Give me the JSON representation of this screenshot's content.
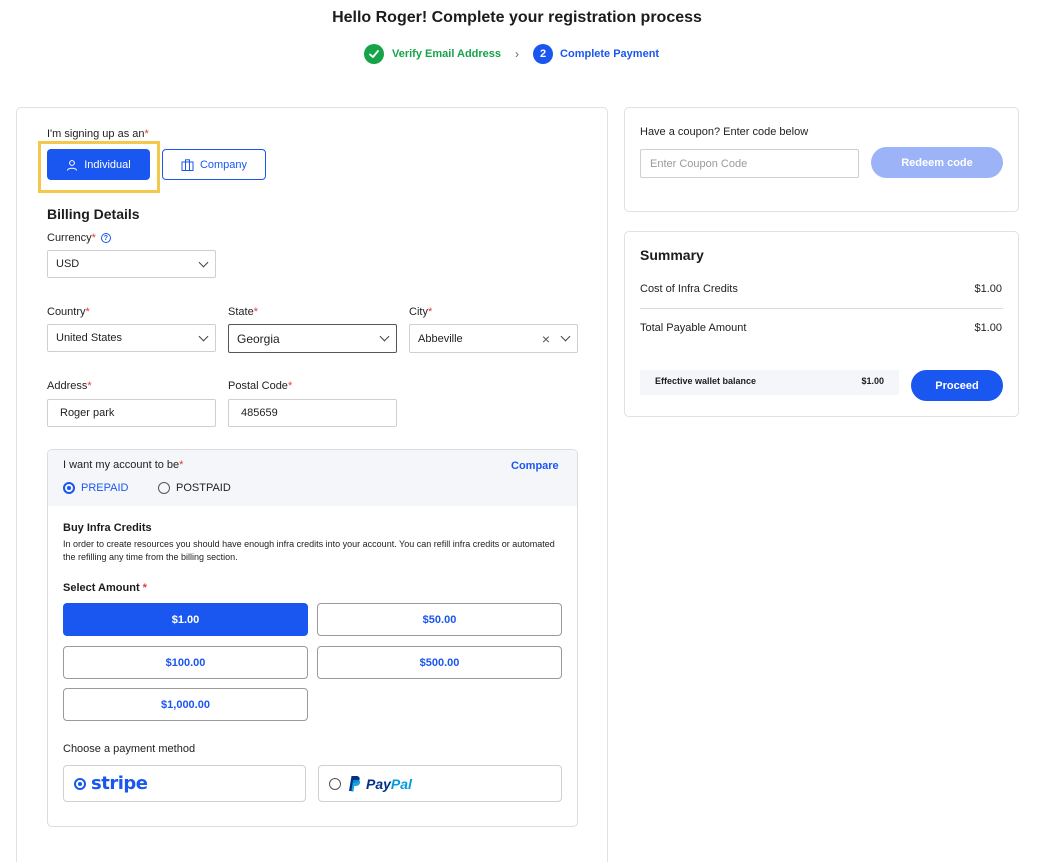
{
  "header": {
    "title": "Hello Roger! Complete your registration process",
    "step1_label": "Verify Email Address",
    "step2_number": "2",
    "step2_label": "Complete Payment"
  },
  "account_type": {
    "label": "I'm signing up as an",
    "individual": "Individual",
    "company": "Company",
    "selected": "Individual"
  },
  "billing": {
    "heading": "Billing Details",
    "currency_label": "Currency",
    "currency_value": "USD",
    "country_label": "Country",
    "country_value": "United States",
    "state_label": "State",
    "state_value": "Georgia",
    "city_label": "City",
    "city_value": "Abbeville",
    "address_label": "Address",
    "address_value": "Roger park",
    "postal_label": "Postal Code",
    "postal_value": "485659"
  },
  "account_mode": {
    "label": "I want my account to be",
    "compare": "Compare",
    "prepaid": "PREPAID",
    "postpaid": "POSTPAID",
    "selected": "PREPAID"
  },
  "credits": {
    "heading": "Buy Infra Credits",
    "description": "In order to create resources you should have enough infra credits into your account. You can refill infra credits or automated the refilling any time from the billing section.",
    "select_label": "Select Amount",
    "amounts": [
      "$1.00",
      "$50.00",
      "$100.00",
      "$500.00",
      "$1,000.00"
    ],
    "selected": "$1.00"
  },
  "payment": {
    "label": "Choose a payment method",
    "stripe": "stripe",
    "paypal_pay": "Pay",
    "paypal_pal": "Pal",
    "selected": "stripe"
  },
  "coupon": {
    "label": "Have a coupon? Enter code below",
    "placeholder": "Enter Coupon Code",
    "button": "Redeem code"
  },
  "summary": {
    "heading": "Summary",
    "cost_label": "Cost of Infra Credits",
    "cost_value": "$1.00",
    "total_label": "Total Payable Amount",
    "total_value": "$1.00",
    "wallet_label": "Effective wallet balance",
    "wallet_value": "$1.00",
    "proceed": "Proceed"
  },
  "colors": {
    "primary": "#1a56f0",
    "success": "#16a34a",
    "highlight": "#f2c94c",
    "required": "#e53935"
  }
}
